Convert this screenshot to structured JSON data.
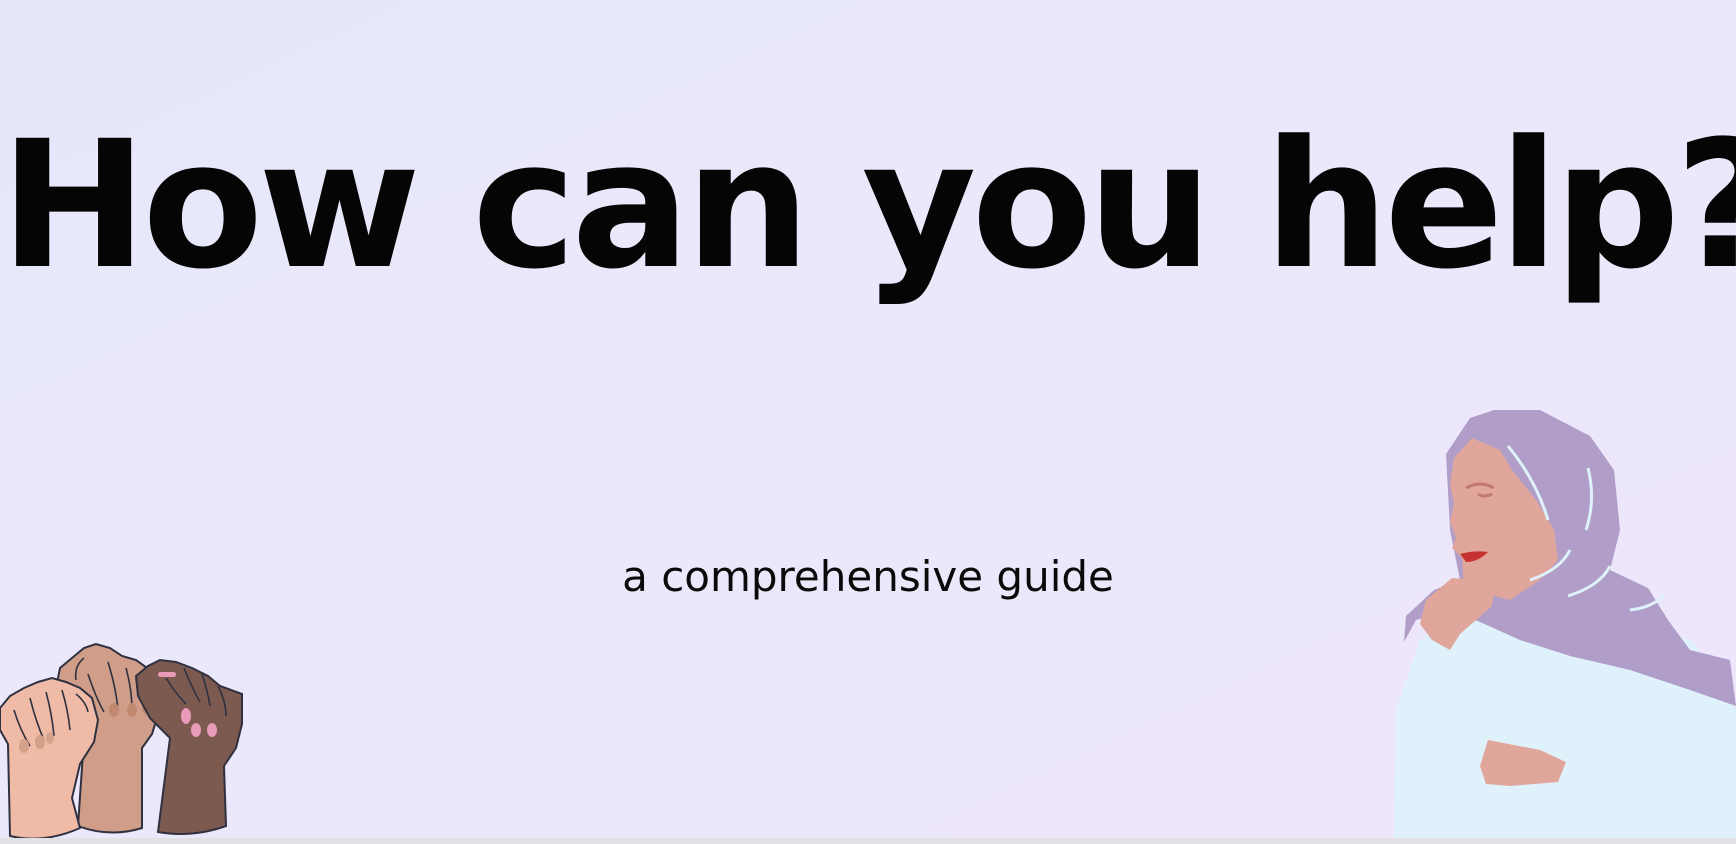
{
  "slide": {
    "title": "How can you help?",
    "subtitle": "a comprehensive guide"
  },
  "illustrations": {
    "left": "raised-fists-illustration",
    "right": "thinking-woman-hijab-illustration"
  },
  "colors": {
    "background_start": "#e6e7fb",
    "background_end": "#efe6fb",
    "title_text": "#050505",
    "skin_light": "#efbba6",
    "skin_medium": "#d09e88",
    "skin_dark": "#7d5a50",
    "hijab": "#b09ec8",
    "shirt": "#dff2fb",
    "nail_pink": "#e89ab8"
  }
}
